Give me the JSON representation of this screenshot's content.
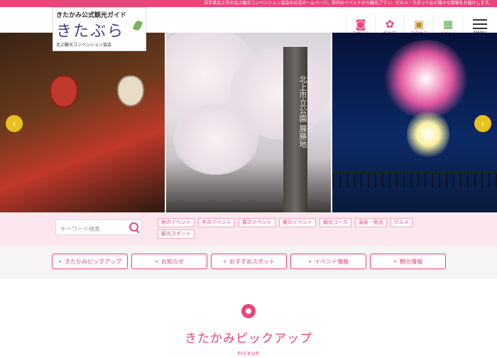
{
  "topbar": {
    "text": "岩手県北上市の北上観光コンベンション協会の公式ホームページ。市内のイベントから観光プラン、グルメ・スポットなど様々な情報をお届けします。"
  },
  "logo": {
    "subtitle": "きたかみ公式観光ガイド",
    "name": "きたぶら",
    "footer": "北上観光コンベンション協会"
  },
  "nav": [
    {
      "label": "スポット",
      "icon": "camera-icon",
      "glyph": "◙"
    },
    {
      "label": "桜と花",
      "icon": "flower-icon",
      "glyph": "✿"
    },
    {
      "label": "アクセス",
      "icon": "bus-icon",
      "glyph": "▣"
    },
    {
      "label": "イベント",
      "icon": "calendar-icon",
      "glyph": "▦"
    },
    {
      "label": "MENU",
      "icon": "menu-icon"
    }
  ],
  "hero": {
    "pillar_text": "北上市立公園 展勝地",
    "prev_glyph": "‹",
    "next_glyph": "›"
  },
  "search": {
    "placeholder": "キーワード検索"
  },
  "tags": [
    "秋のイベント",
    "冬のイベント",
    "春のイベント",
    "夏のイベント",
    "観光コース",
    "温泉・宿泊",
    "グルメ",
    "観光スポット"
  ],
  "menu": [
    "きたかみピックアップ",
    "お知らせ",
    "おすすめスポット",
    "イベント情報",
    "観光情報"
  ],
  "menu_chevron": "∨",
  "pickup": {
    "title": "きたかみピックアップ",
    "subtitle": "PICKUP"
  },
  "colors": {
    "accent": "#e8467b",
    "arrow": "#e8c020",
    "search_bg": "#fde7ee"
  }
}
